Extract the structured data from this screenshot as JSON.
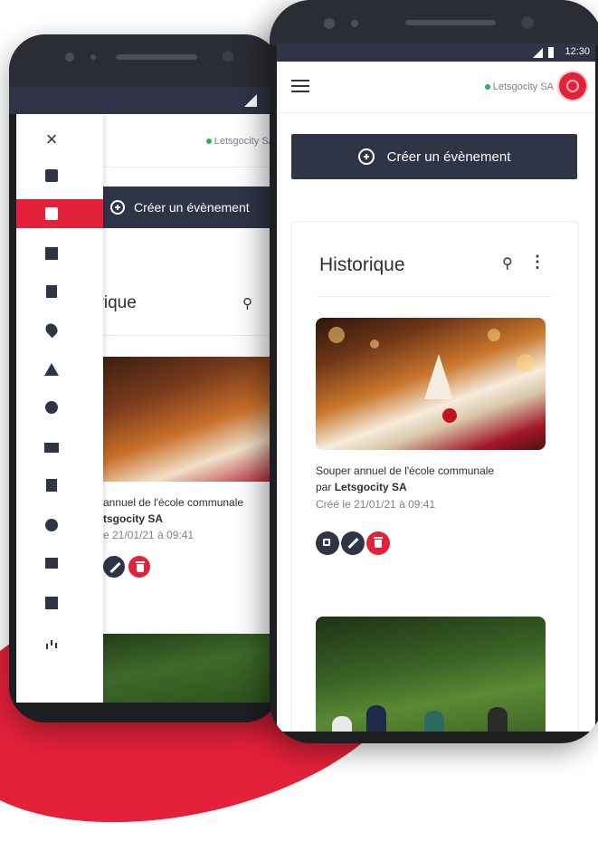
{
  "app": {
    "company": "Letsgocity SA",
    "status_time": "12:30"
  },
  "actions": {
    "create_event": "Créer un évènement"
  },
  "history": {
    "title": "Historique",
    "events": [
      {
        "title": "Souper annuel de l'école communale",
        "by_prefix": "par ",
        "organizer": "Letsgocity SA",
        "created": "Créé le 21/01/21 à 09:41"
      }
    ]
  },
  "back_phone": {
    "history_title_visible": "orique",
    "event_title_visible": "annuel de l'école communale",
    "organizer_visible": "tsgocity SA",
    "created_visible": "e 21/01/21 à 09:41"
  },
  "drawer": {
    "close_glyph": "×",
    "items": [
      {
        "icon": "chat-icon"
      },
      {
        "icon": "calendar-icon",
        "active": true
      },
      {
        "icon": "bar-chart-icon"
      },
      {
        "icon": "document-icon"
      },
      {
        "icon": "location-pin-icon"
      },
      {
        "icon": "warning-icon"
      },
      {
        "icon": "palette-icon"
      },
      {
        "icon": "card-icon"
      },
      {
        "icon": "map-icon"
      },
      {
        "icon": "settings-icon"
      },
      {
        "icon": "store-icon"
      },
      {
        "icon": "dashboard-icon"
      },
      {
        "icon": "stats-icon"
      }
    ]
  },
  "colors": {
    "primary_dark": "#2f3447",
    "accent_red": "#e3213a",
    "status_online": "#2ab35a"
  }
}
